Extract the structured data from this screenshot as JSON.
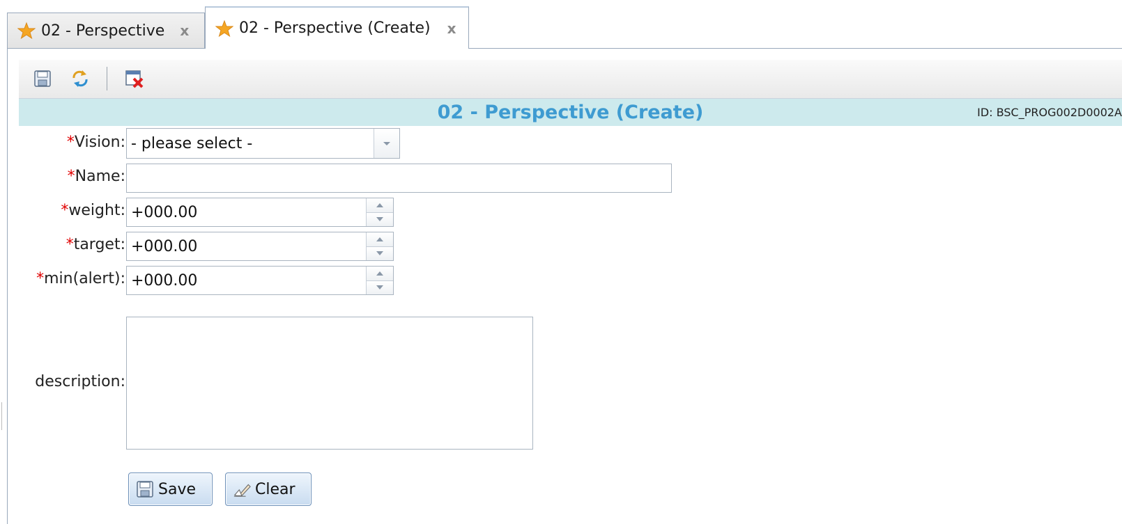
{
  "tabs": [
    {
      "label": "02 - Perspective",
      "close": "x",
      "active": false
    },
    {
      "label": "02 - Perspective (Create)",
      "close": "x",
      "active": true
    }
  ],
  "toolbar": {
    "save_icon": "save-disk-icon",
    "refresh_icon": "refresh-icon",
    "close_icon": "close-window-icon"
  },
  "header": {
    "title": "02 - Perspective (Create)",
    "program_id": "ID: BSC_PROG002D0002A"
  },
  "form": {
    "required_mark": "*",
    "vision": {
      "label": "Vision:",
      "value": "- please select -"
    },
    "name": {
      "label": "Name:",
      "value": ""
    },
    "weight": {
      "label": "weight:",
      "value": "+000.00"
    },
    "target": {
      "label": "target:",
      "value": "+000.00"
    },
    "min_alert": {
      "label": "min(alert):",
      "value": "+000.00"
    },
    "description": {
      "label": "description:",
      "value": ""
    }
  },
  "buttons": {
    "save_label": "Save",
    "clear_label": "Clear"
  },
  "colors": {
    "title": "#3e9bd1",
    "titlebar_bg": "#cdeaed",
    "required": "#e00000",
    "star": "#f5a623"
  }
}
